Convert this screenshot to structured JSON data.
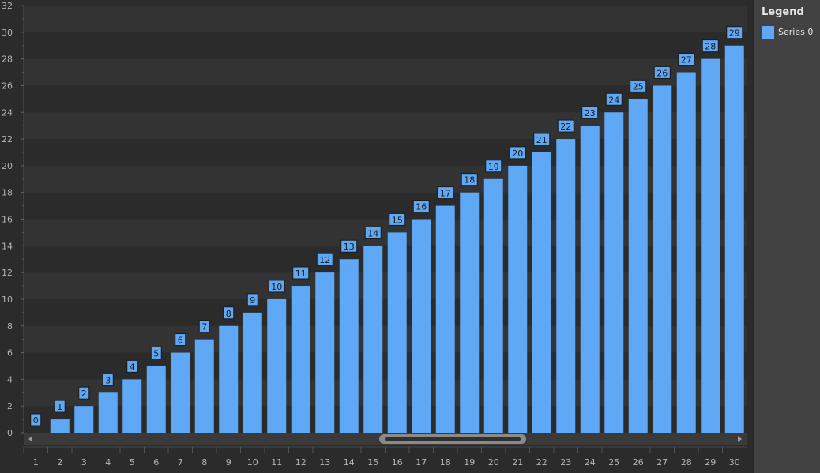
{
  "chart_data": {
    "type": "bar",
    "categories": [
      "1",
      "2",
      "3",
      "4",
      "5",
      "6",
      "7",
      "8",
      "9",
      "10",
      "11",
      "12",
      "13",
      "14",
      "15",
      "16",
      "17",
      "18",
      "19",
      "20",
      "21",
      "22",
      "23",
      "24",
      "25",
      "26",
      "27",
      "28",
      "29",
      "30"
    ],
    "series": [
      {
        "name": "Series 0",
        "values": [
          0,
          1,
          2,
          3,
          4,
          5,
          6,
          7,
          8,
          9,
          10,
          11,
          12,
          13,
          14,
          15,
          16,
          17,
          18,
          19,
          20,
          21,
          22,
          23,
          24,
          25,
          26,
          27,
          28,
          29
        ]
      }
    ],
    "data_labels": [
      "0",
      "1",
      "2",
      "3",
      "4",
      "5",
      "6",
      "7",
      "8",
      "9",
      "10",
      "11",
      "12",
      "13",
      "14",
      "15",
      "16",
      "17",
      "18",
      "19",
      "20",
      "21",
      "22",
      "23",
      "24",
      "25",
      "26",
      "27",
      "28",
      "29"
    ],
    "y_ticks": [
      "0",
      "2",
      "4",
      "6",
      "8",
      "10",
      "12",
      "14",
      "16",
      "18",
      "20",
      "22",
      "24",
      "26",
      "28",
      "30",
      "32"
    ],
    "ylim": [
      0,
      32
    ],
    "title": "",
    "xlabel": "",
    "ylabel": "",
    "grid": "alternating horizontal bands",
    "legend_position": "right",
    "colors": {
      "bar": "#5ea8f5",
      "label_bg": "#5ea8f5",
      "label_border": "#1a1a1a",
      "label_text": "#1a1a1a",
      "band_dark": "#2b2b2b",
      "band_light": "#333333",
      "axis_text": "#b4b4b4",
      "background": "#2b2b2b",
      "scrollbar_track": "#3a3a3a",
      "scrollbar_thumb": "#8a8a8a"
    }
  },
  "legend": {
    "title": "Legend",
    "items": [
      {
        "label": "Series 0"
      }
    ]
  },
  "scrollbar": {
    "left_arrow_icon": "triangle-left-icon",
    "right_arrow_icon": "triangle-right-icon"
  }
}
